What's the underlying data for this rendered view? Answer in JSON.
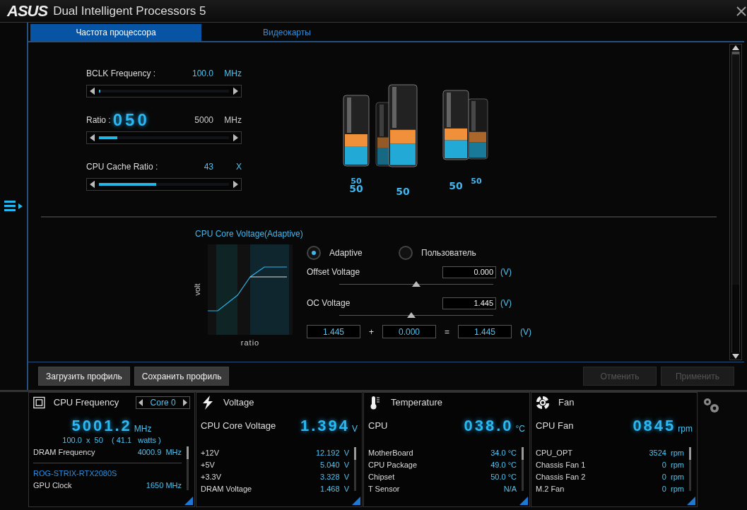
{
  "window": {
    "brand": "ASUS",
    "title": "Dual Intelligent Processors 5"
  },
  "tabs": [
    {
      "label": "Частота процессора",
      "selected": true
    },
    {
      "label": "Видеокарты",
      "selected": false
    }
  ],
  "sliders": [
    {
      "label": "BCLK Frequency :",
      "value": "100.0",
      "unit": "MHz",
      "accent": true,
      "level": 0.01
    },
    {
      "label": "Ratio :",
      "display": "050",
      "value": "5000",
      "unit": "MHz",
      "accent": false,
      "level": 0.14
    },
    {
      "label": "CPU Cache Ratio :",
      "value": "43",
      "unit": "X",
      "accent": true,
      "level": 0.44
    }
  ],
  "cores": [
    "50",
    "50",
    "50",
    "50",
    "50"
  ],
  "voltage": {
    "title": "CPU Core Voltage(Adaptive)",
    "ylabel": "volt",
    "xlabel": "ratio",
    "modes": [
      {
        "label": "Adaptive",
        "selected": true
      },
      {
        "label": "Пользователь",
        "selected": false
      }
    ],
    "fields": [
      {
        "label": "Offset Voltage",
        "value": "0.000",
        "unit": "(V)",
        "level": 0.5
      },
      {
        "label": "OC Voltage",
        "value": "1.445",
        "unit": "(V)",
        "level": 0.47
      }
    ],
    "sum": {
      "a": "1.445",
      "plus": "+",
      "b": "0.000",
      "equals": "=",
      "result": "1.445",
      "unit": "(V)"
    }
  },
  "actions": [
    {
      "label": "Загрузить профиль",
      "disabled": false
    },
    {
      "label": "Сохранить профиль",
      "disabled": false
    },
    {
      "label": "Отменить",
      "disabled": true
    },
    {
      "label": "Применить",
      "disabled": true
    }
  ],
  "monitor": [
    {
      "kind": "cpu",
      "title": "CPU Frequency",
      "selector": "Core 0",
      "value": "5001.2",
      "unit": "MHz",
      "sub": "100.0  x  50    ( 41.1   watts )",
      "rows": [
        {
          "kind": "row",
          "label": "DRAM Frequency",
          "value": "4000.9  MHz"
        },
        {
          "kind": "divider"
        },
        {
          "kind": "heading",
          "label": "ROG-STRIX-RTX2080S"
        },
        {
          "kind": "row",
          "label": "GPU Clock",
          "value": "1650 MHz"
        }
      ]
    },
    {
      "kind": "voltage",
      "title": "Voltage",
      "label": "CPU Core Voltage",
      "value": "1.394",
      "unit": "V",
      "rows": [
        {
          "kind": "row",
          "label": "+12V",
          "value": "12.192  V"
        },
        {
          "kind": "row",
          "label": "+5V",
          "value": "5.040  V"
        },
        {
          "kind": "row",
          "label": "+3.3V",
          "value": "3.328  V"
        },
        {
          "kind": "row",
          "label": "DRAM Voltage",
          "value": "1.468  V"
        }
      ]
    },
    {
      "kind": "temperature",
      "title": "Temperature",
      "label": "CPU",
      "value": "038.0",
      "unit": "°C",
      "rows": [
        {
          "kind": "row",
          "label": "MotherBoard",
          "value": "34.0 °C"
        },
        {
          "kind": "row",
          "label": "CPU Package",
          "value": "49.0 °C"
        },
        {
          "kind": "row",
          "label": "Chipset",
          "value": "50.0 °C"
        },
        {
          "kind": "row",
          "label": "T Sensor",
          "value": "N/A"
        }
      ]
    },
    {
      "kind": "fan",
      "title": "Fan",
      "label": "CPU Fan",
      "value": "0845",
      "unit": "rpm",
      "rows": [
        {
          "kind": "row",
          "label": "CPU_OPT",
          "value": "3524  rpm"
        },
        {
          "kind": "row",
          "label": "Chassis Fan 1",
          "value": "0  rpm"
        },
        {
          "kind": "row",
          "label": "Chassis Fan 2",
          "value": "0  rpm"
        },
        {
          "kind": "row",
          "label": "M.2 Fan",
          "value": "0  rpm"
        }
      ]
    }
  ]
}
